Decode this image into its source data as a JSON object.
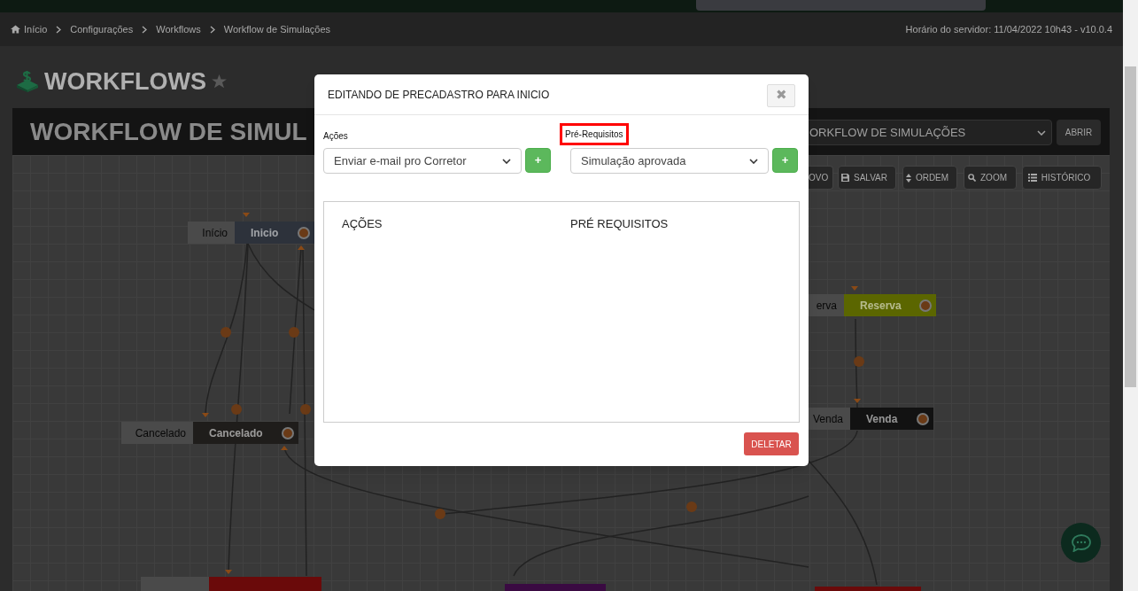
{
  "breadcrumb": [
    "Início",
    "Configurações",
    "Workflows",
    "Workflow de Simulações"
  ],
  "server_time": "Horário do servidor: 11/04/2022 10h43 - v10.0.4",
  "page_title": "WORKFLOWS",
  "banner_title": "WORKFLOW DE SIMUL",
  "workflow_select": {
    "value": "ORKFLOW DE SIMULAÇÕES"
  },
  "open_button": "ABRIR",
  "toolbar": [
    "OVO",
    "SALVAR",
    "ORDEM",
    "ZOOM",
    "HISTÓRICO"
  ],
  "nodes": [
    {
      "tag": "Início",
      "name": "Inicio",
      "color": "#2d323b"
    },
    {
      "tag": "Cancelado",
      "name": "Cancelado",
      "color": "#1f1d1b"
    },
    {
      "tag": "erva",
      "name": "Reserva",
      "color": "#5b6600"
    },
    {
      "tag": "Venda",
      "name": "Venda",
      "color": "#121212"
    }
  ],
  "modal": {
    "title": "EDITANDO DE PRECADASTRO PARA INICIO",
    "close": "✖",
    "fields": [
      {
        "label": "Ações",
        "value": "Enviar e-mail pro Corretor",
        "highlighted": false,
        "add": "+"
      },
      {
        "label": "Pré-Requisitos",
        "value": "Simulação aprovada",
        "highlighted": true,
        "add": "+"
      }
    ],
    "columns": [
      "AÇÕES",
      "PRÉ REQUISITOS"
    ],
    "delete_button": "DELETAR"
  }
}
